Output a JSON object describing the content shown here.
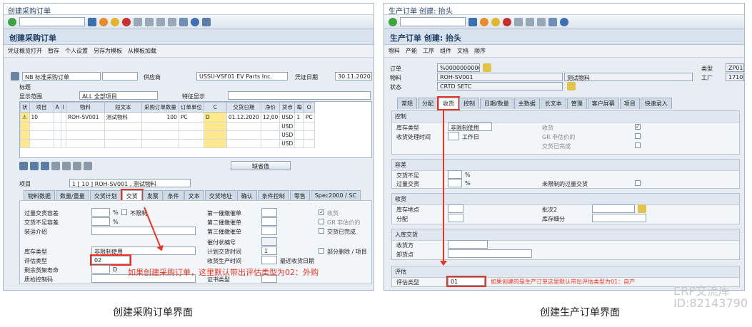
{
  "left": {
    "window_title": "创建采购订单",
    "heading": "创建采购订单",
    "appbar": [
      "凭证概览打开",
      "暂存",
      "个人设置",
      "另存为模板",
      "从模板加载"
    ],
    "doc_type": "NB 标准采购订单",
    "vendor_label": "供应商",
    "vendor": "USSU-VSF01 EV Parts Inc.",
    "doc_date_label": "凭证日期",
    "doc_date": "30.11.2020",
    "header_label": "标题",
    "display_range_label": "显示范围",
    "display_range": "ALL 全部项目",
    "feature_label": "特征显示",
    "grid_headers": [
      "状",
      "项目",
      "A",
      "I",
      "物料",
      "短文本",
      "采购订单数量",
      "订单单位",
      "C",
      "交货日期",
      "净价",
      "货币",
      "每",
      "O"
    ],
    "grid_row": [
      "10",
      "ROH-SV001",
      "测试物料",
      "100",
      "PC",
      "D",
      "01.12.2020",
      "12,00",
      "USD",
      "1",
      "PC"
    ],
    "grid_currency": "USD",
    "default_values_btn": "缺省值",
    "item_label": "项目",
    "item_value": "1 [ 10 ] ROH-SV001 , 测试物料",
    "tabs": [
      "物料数据",
      "数量/重量",
      "交货计划",
      "交货",
      "发票",
      "条件",
      "文本",
      "交货地址",
      "确认",
      "条件控制",
      "零售",
      "Spec2000 / SC"
    ],
    "active_tab": "交货",
    "f_over": "过量交货容差",
    "f_under": "交货不足容差",
    "f_unlimited": "不限制",
    "f_shipping": "装运介绍",
    "f_stock_type": "库存类型",
    "f_stock_type_val": "非限制使用",
    "f_valtype": "评估类型",
    "f_valtype_val": "02",
    "f_shelf": "剩余货架寿命",
    "f_shelf_unit": "D",
    "f_qc": "质检控制码",
    "r_reminder1": "第一催缴催单",
    "r_reminder2": "第二催缴催单",
    "r_reminder3": "第三催缴催单",
    "r_dunning": "催付状编号",
    "r_plan_time": "计划交货时间",
    "r_plan_time_val": "1",
    "r_gr_time": "收货生产时间",
    "r_latest_gr": "最近收货日期",
    "r_cert": "证书类型",
    "c_gr": "收货",
    "c_gr_nonval": "GR 非估价的",
    "c_delivery_done": "交货已完成",
    "c_partial": "部分删除 / 项目",
    "annotation": "如果创建采购订单，这里默认带出评估类型为02：外购"
  },
  "right": {
    "window_title": "生产订单 创建: 抬头",
    "heading": "生产订单 创建: 抬头",
    "appbar": [
      "物料",
      "产能",
      "工序",
      "组件",
      "文档",
      "顺序"
    ],
    "order_label": "订单",
    "order": "%00000000001",
    "type_label": "类型",
    "type": "ZP01",
    "material_label": "物料",
    "material": "ROH-SV001",
    "material_desc": "测试物料",
    "plant_label": "工厂",
    "plant": "1710",
    "status_label": "状态",
    "status": "CRTD SETC",
    "tabs": [
      "常规",
      "分配",
      "收货",
      "控制",
      "日期/数量",
      "主数据",
      "长文本",
      "管理",
      "客户屏幕",
      "项目",
      "快速录入"
    ],
    "active_tab": "收货",
    "g_control": "控制",
    "stock_type": "库存类型",
    "stock_type_val": "非限制使用",
    "gr_proc_time": "收货处理时间",
    "workdays": "工作日",
    "gr": "收货",
    "gr_nonval": "GR 非估价的",
    "delivery_done": "交货已完成",
    "g_tolerance": "容差",
    "under_tol": "交货不足",
    "over_tol": "过量交货",
    "unlimited_over": "未限制的过量交货",
    "g_gr": "收货",
    "storage_loc": "库存地点",
    "batch": "批次2",
    "distribution": "分配",
    "stock_seg": "库存细分",
    "g_receipt": "入库交货",
    "recipient": "收货方",
    "unloading": "卸货点",
    "g_val": "评估",
    "valtype": "评估类型",
    "valtype_val": "01",
    "annotation": "如果创建的是生产订单这里默认带出评估类型为01：自产"
  },
  "captions": {
    "left": "创建采购订单界面",
    "right": "创建生产订单界面"
  },
  "watermark": {
    "name": "ERP交流库",
    "id": "ID:82143790"
  },
  "colors": {
    "accent_red": "#ee3322",
    "header_blue": "#1f3e66"
  }
}
